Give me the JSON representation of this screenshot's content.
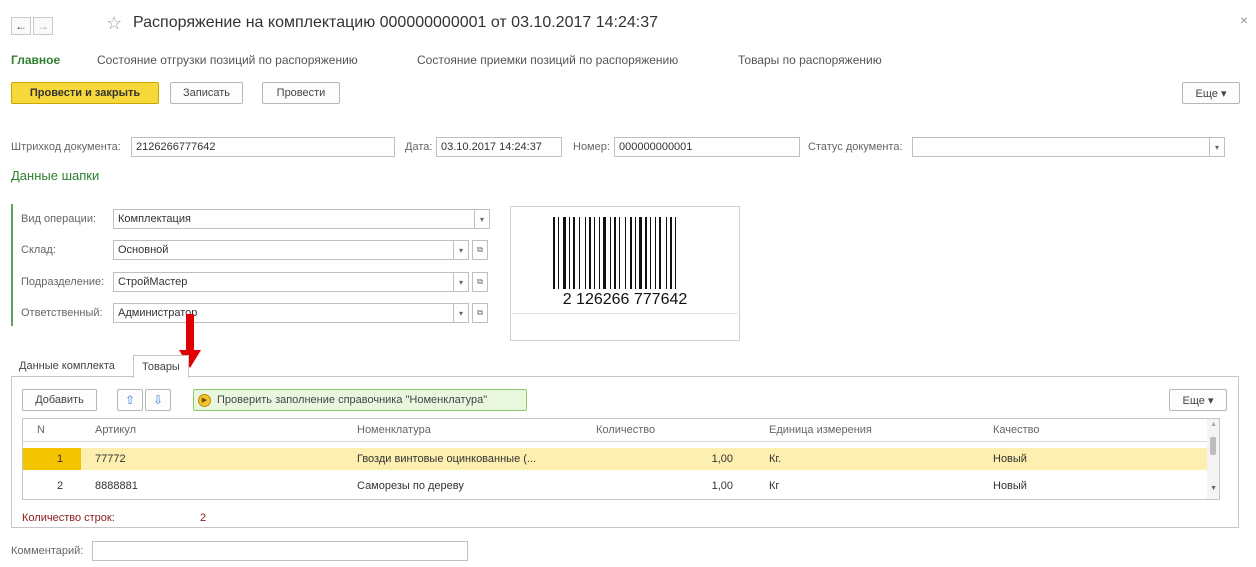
{
  "window": {
    "title": "Распоряжение на комплектацию 000000000001 от 03.10.2017 14:24:37",
    "back_icon": "←",
    "forward_icon": "→",
    "star_icon": "☆",
    "close_icon": "×"
  },
  "nav": {
    "main": "Главное",
    "shipping_state": "Состояние отгрузки позиций по распоряжению",
    "receiving_state": "Состояние приемки позиций по распоряжению",
    "goods": "Товары по распоряжению"
  },
  "toolbar": {
    "post_close": "Провести и закрыть",
    "save": "Записать",
    "post": "Провести",
    "more": "Еще ▾"
  },
  "doc": {
    "barcode_label": "Штрихкод документа:",
    "barcode_value": "2126266777642",
    "date_label": "Дата:",
    "date_value": "03.10.2017 14:24:37",
    "number_label": "Номер:",
    "number_value": "000000000001",
    "status_label": "Статус документа:",
    "status_value": ""
  },
  "header_section": {
    "title": "Данные шапки",
    "operation_label": "Вид операции:",
    "operation_value": "Комплектация",
    "warehouse_label": "Склад:",
    "warehouse_value": "Основной",
    "department_label": "Подразделение:",
    "department_value": "СтройМастер",
    "responsible_label": "Ответственный:",
    "responsible_value": "Администратор"
  },
  "barcode_image": {
    "digits": "2 126266 777642"
  },
  "tabs": {
    "kit_data": "Данные комплекта",
    "goods": "Товары"
  },
  "goods_toolbar": {
    "add": "Добавить",
    "up_icon": "⇧",
    "down_icon": "⇩",
    "check_catalog": "Проверить заполнение справочника \"Номенклатура\"",
    "more": "Еще ▾"
  },
  "table": {
    "headers": [
      "N",
      "Артикул",
      "Номенклатура",
      "Количество",
      "Единица измерения",
      "Качество"
    ],
    "rows": [
      {
        "n": "1",
        "article": "77772",
        "item": "Гвозди винтовые оцинкованные (...",
        "qty": "1,00",
        "unit": "Кг.",
        "quality": "Новый"
      },
      {
        "n": "2",
        "article": "8888881",
        "item": "Саморезы по дереву",
        "qty": "1,00",
        "unit": "Кг",
        "quality": "Новый"
      }
    ]
  },
  "footer": {
    "rows_count_label": "Количество строк:",
    "rows_count_value": "2",
    "comment_label": "Комментарий:",
    "comment_value": ""
  },
  "colors": {
    "accent_green": "#2f7f2f",
    "primary_button": "#f6d83a",
    "selected_row": "#fcefaf",
    "annotation_arrow": "#e00000"
  }
}
